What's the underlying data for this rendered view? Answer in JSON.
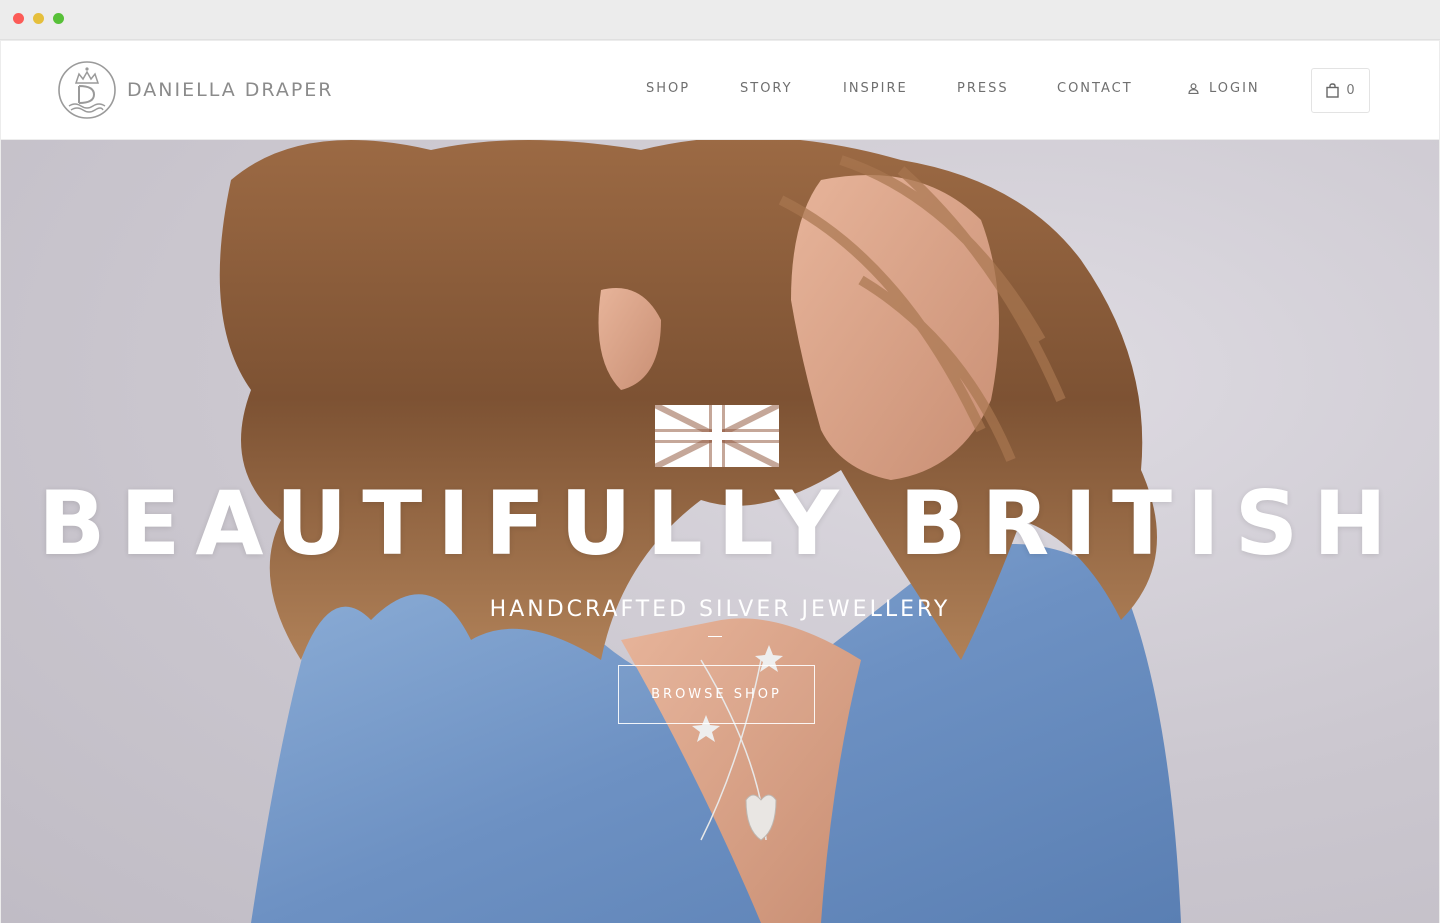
{
  "brand": {
    "name": "DANIELLA DRAPER",
    "logo_icon": "crown-d-monogram-icon"
  },
  "nav": {
    "items": [
      {
        "label": "SHOP"
      },
      {
        "label": "STORY"
      },
      {
        "label": "INSPIRE"
      },
      {
        "label": "PRESS"
      },
      {
        "label": "CONTACT"
      }
    ],
    "login_label": "LOGIN",
    "login_icon": "user-icon",
    "cart_icon": "shopping-bag-icon",
    "cart_count": "0"
  },
  "hero": {
    "flag_icon": "union-jack-icon",
    "title": "BEAUTIFULLY BRITISH",
    "subtitle": "HANDCRAFTED SILVER JEWELLERY",
    "cta_label": "BROWSE SHOP"
  },
  "colors": {
    "nav_text": "#6f6f6f",
    "logo_text": "#8b8b8b",
    "hero_text": "#ffffff",
    "hero_background": "#cbc7cf",
    "denim": "#6f93c4",
    "hair": "#8a5a34"
  }
}
